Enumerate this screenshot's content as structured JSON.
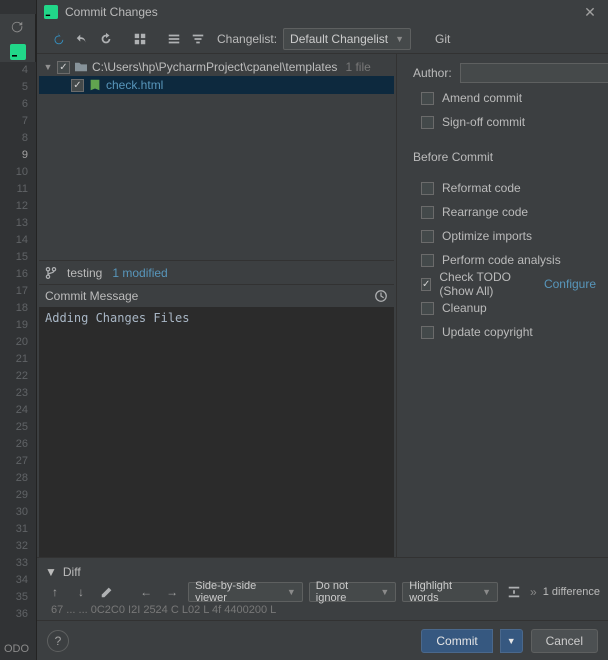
{
  "editor": {
    "line_start": 4,
    "line_end": 36,
    "active_line": 9
  },
  "bottom_status": "ODO",
  "dialog_title": "Commit Changes",
  "changelist_label": "Changelist:",
  "changelist_selected": "Default Changelist",
  "vcs_label": "Git",
  "tree": {
    "root_path": "C:\\Users\\hp\\PycharmProject\\cpanel\\templates",
    "root_count": "1 file",
    "file_name": "check.html"
  },
  "branch": {
    "name": "testing",
    "modified": "1 modified"
  },
  "commit_message_label": "Commit Message",
  "commit_message_value": "Adding Changes Files",
  "right": {
    "author_label": "Author:",
    "amend": "Amend commit",
    "signoff": "Sign-off commit",
    "before_commit": "Before Commit",
    "reformat": "Reformat code",
    "rearrange": "Rearrange code",
    "optimize": "Optimize imports",
    "analysis": "Perform code analysis",
    "check_todo": "Check TODO (Show All)",
    "configure": "Configure",
    "cleanup": "Cleanup",
    "update_copyright": "Update copyright"
  },
  "diff": {
    "header": "Diff",
    "viewer": "Side-by-side viewer",
    "ignore": "Do not ignore",
    "highlight": "Highlight words",
    "count": "1 difference",
    "status_left": "67 ... ... 0C2C0 I2I 2524  C  L02  L  4f  4400200 L"
  },
  "buttons": {
    "commit": "Commit",
    "cancel": "Cancel"
  }
}
